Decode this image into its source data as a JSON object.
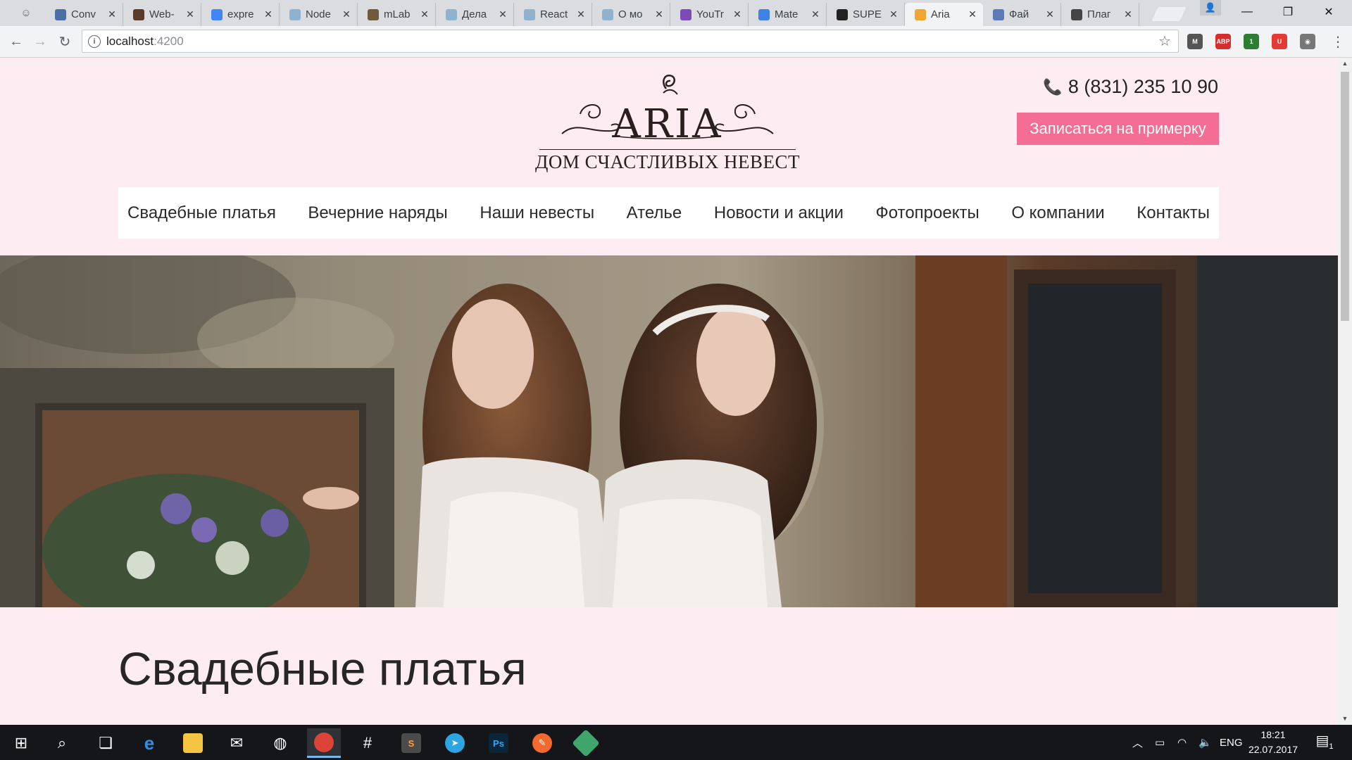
{
  "browser": {
    "tabs": [
      {
        "title": "Conv",
        "favicon_color": "#4a6fa5"
      },
      {
        "title": "Web-",
        "favicon_color": "#5b3a29"
      },
      {
        "title": "expre",
        "favicon_color": "#4285f4"
      },
      {
        "title": "Node",
        "favicon_color": "#8fb3cf"
      },
      {
        "title": "mLab",
        "favicon_color": "#6d5b3b"
      },
      {
        "title": "Дела",
        "favicon_color": "#8fb3cf"
      },
      {
        "title": "React",
        "favicon_color": "#8fb3cf"
      },
      {
        "title": "О мо",
        "favicon_color": "#8fb3cf"
      },
      {
        "title": "YouTr",
        "favicon_color": "#7b4bb8"
      },
      {
        "title": "Mate",
        "favicon_color": "#3f83e6"
      },
      {
        "title": "SUPE",
        "favicon_color": "#222222"
      },
      {
        "title": "Aria",
        "favicon_color": "#f2a530"
      },
      {
        "title": "Фай",
        "favicon_color": "#5a7bb5"
      },
      {
        "title": "Плаг",
        "favicon_color": "#444444"
      }
    ],
    "active_tab_index": 11,
    "url_host": "localhost",
    "url_port": ":4200",
    "extensions": [
      {
        "label": "M",
        "color": "#555555"
      },
      {
        "label": "ABP",
        "color": "#d32f2f"
      },
      {
        "label": "1",
        "color": "#2e7d32"
      },
      {
        "label": "U",
        "color": "#e53935"
      },
      {
        "label": "◉",
        "color": "#777777"
      }
    ]
  },
  "site": {
    "logo_title": "ARIA",
    "logo_subtitle": "ДОМ СЧАСТЛИВЫХ НЕВЕСТ",
    "phone": "8 (831) 235 10 90",
    "cta_label": "Записаться на примерку",
    "accent_color": "#f46d95",
    "background_color": "#fdecf1",
    "menu": [
      "Свадебные платья",
      "Вечерние наряды",
      "Наши невесты",
      "Ателье",
      "Новости и акции",
      "Фотопроекты",
      "О компании",
      "Контакты"
    ],
    "page_title": "Свадебные платья"
  },
  "taskbar": {
    "language": "ENG",
    "time": "18:21",
    "date": "22.07.2017",
    "notifications": "1"
  }
}
